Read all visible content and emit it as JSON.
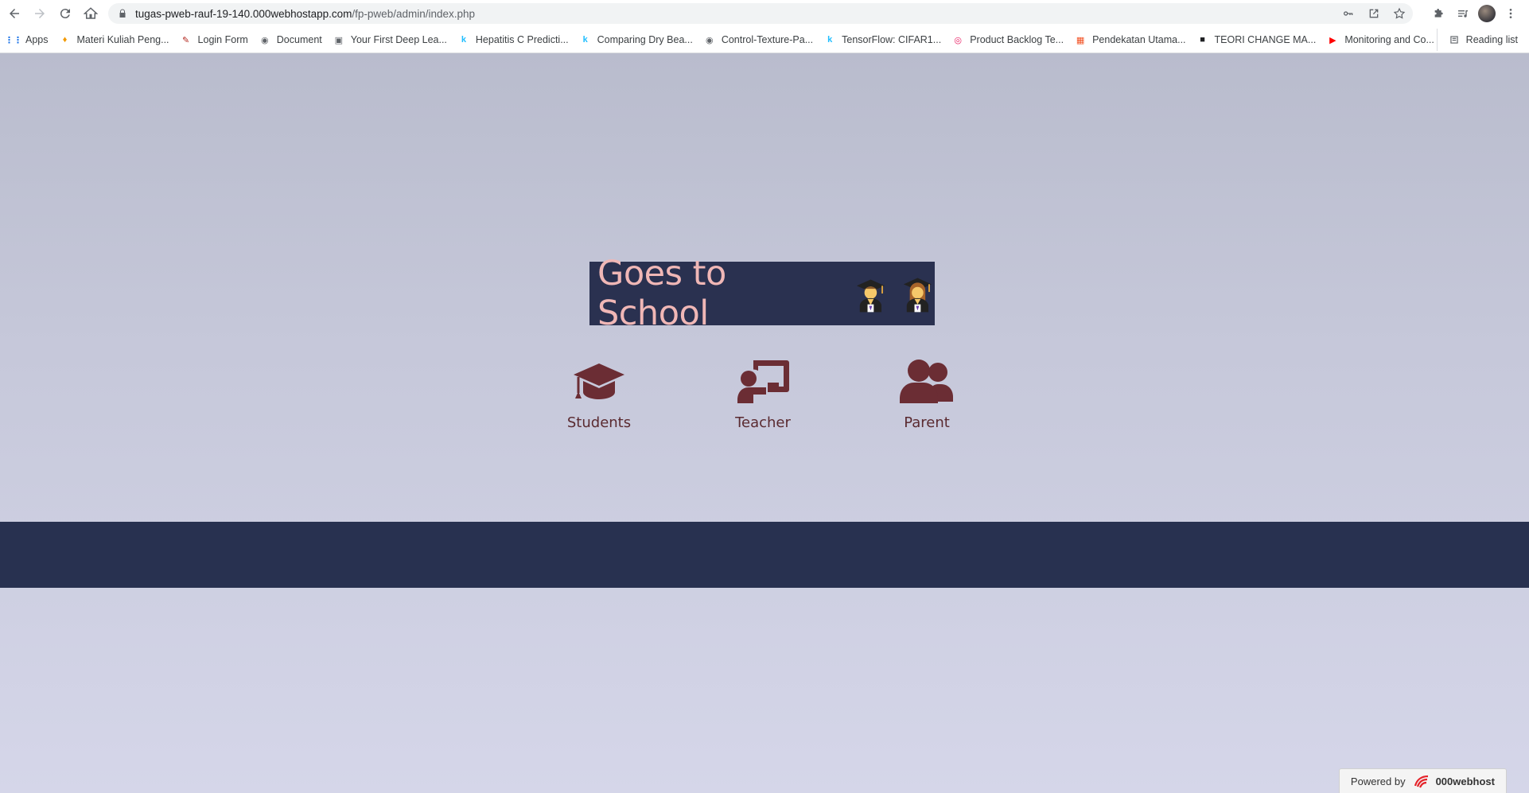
{
  "browser": {
    "url_host": "tugas-pweb-rauf-19-140.000webhostapp.com",
    "url_path": "/fp-pweb/admin/index.php",
    "bookmarks": [
      {
        "label": "Apps",
        "icon": "apps-grid-icon",
        "color": "#1a73e8"
      },
      {
        "label": "Materi Kuliah Peng...",
        "icon": "flame-icon",
        "color": "#f29900"
      },
      {
        "label": "Login Form",
        "icon": "login-form-icon",
        "color": "#b3261e"
      },
      {
        "label": "Document",
        "icon": "globe-icon",
        "color": "#5f6368"
      },
      {
        "label": "Your First Deep Lea...",
        "icon": "image-thumb-icon",
        "color": "#5f6368"
      },
      {
        "label": "Hepatitis C Predicti...",
        "icon": "kaggle-icon",
        "color": "#20beff"
      },
      {
        "label": "Comparing Dry Bea...",
        "icon": "kaggle-icon",
        "color": "#20beff"
      },
      {
        "label": "Control-Texture-Pa...",
        "icon": "globe-icon",
        "color": "#5f6368"
      },
      {
        "label": "TensorFlow: CIFAR1...",
        "icon": "kaggle-icon",
        "color": "#20beff"
      },
      {
        "label": "Product Backlog Te...",
        "icon": "backlog-icon",
        "color": "#e91e63"
      },
      {
        "label": "Pendekatan Utama...",
        "icon": "microsoft-icon",
        "color": "#f25022"
      },
      {
        "label": "TEORI CHANGE MA...",
        "icon": "dark-square-icon",
        "color": "#202124"
      },
      {
        "label": "Monitoring and Co...",
        "icon": "youtube-icon",
        "color": "#ff0000"
      }
    ],
    "reading_list": "Reading list"
  },
  "page": {
    "title": "Goes to School",
    "roles": [
      {
        "label": "Students",
        "icon": "graduation-cap-icon"
      },
      {
        "label": "Teacher",
        "icon": "chalkboard-teacher-icon"
      },
      {
        "label": "Parent",
        "icon": "users-icon"
      }
    ],
    "colors": {
      "title_bg": "#2a3150",
      "title_text": "#f0b7b6",
      "role_icon": "#6b2d34",
      "footer_band": "#283150"
    }
  },
  "footer": {
    "powered_by": "Powered by",
    "brand": "000webhost"
  }
}
